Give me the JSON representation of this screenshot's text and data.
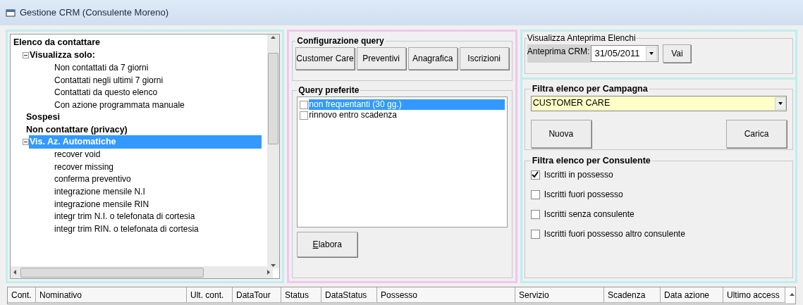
{
  "window": {
    "title": "Gestione CRM (Consulente Moreno)"
  },
  "tree": {
    "label": "Elenco da contattare",
    "selected": false,
    "children": [
      {
        "label": "Visualizza solo:",
        "selected": false,
        "expanded": true,
        "children": [
          {
            "label": "Non contattati da 7 giorni",
            "selected": false
          },
          {
            "label": "Contattati negli ultimi 7 giorni",
            "selected": false
          },
          {
            "label": "Contattati da questo elenco",
            "selected": false
          },
          {
            "label": "Con azione programmata manuale",
            "selected": false
          }
        ]
      },
      {
        "label": "Sospesi",
        "selected": false
      },
      {
        "label": "Non contattare (privacy)",
        "selected": false
      },
      {
        "label": "Vis. Az. Automatiche",
        "selected": true,
        "expanded": true,
        "children": [
          {
            "label": "recover void",
            "selected": false
          },
          {
            "label": "recover missing",
            "selected": false
          },
          {
            "label": "conferma preventivo",
            "selected": false
          },
          {
            "label": "integrazione mensile N.I",
            "selected": false
          },
          {
            "label": "integrazione mensile RIN",
            "selected": false
          },
          {
            "label": "integr trim N.I. o telefonata di cortesia",
            "selected": false
          },
          {
            "label": "integr trim RIN. o telefonata di cortesia",
            "selected": false
          }
        ]
      }
    ]
  },
  "query_config": {
    "title": "Configurazione query",
    "buttons": [
      "Customer Care",
      "Preventivi",
      "Anagrafica",
      "Iscrizioni"
    ]
  },
  "favorite_queries": {
    "title": "Query preferite",
    "items": [
      {
        "label": "non frequentanti (30 gg.)",
        "checked": false,
        "selected": true
      },
      {
        "label": "rinnovo entro scadenza",
        "checked": false,
        "selected": false
      }
    ],
    "button": "Elabora"
  },
  "preview": {
    "title": "Visualizza Anteprima Elenchi",
    "label": "Anteprima CRM:",
    "date": "31/05/2011",
    "button": "Vai"
  },
  "campaign_filter": {
    "title": "Filtra elenco per Campagna",
    "value": "CUSTOMER CARE",
    "buttons": [
      "Nuova",
      "Carica"
    ]
  },
  "consultant_filter": {
    "title": "Filtra elenco per Consulente",
    "options": [
      {
        "label": "Iscritti in possesso",
        "checked": true
      },
      {
        "label": "Iscritti fuori possesso",
        "checked": false
      },
      {
        "label": "Iscritti senza consulente",
        "checked": false
      },
      {
        "label": "Iscritti fuori possesso altro consulente",
        "checked": false
      }
    ]
  },
  "table": {
    "columns": [
      "Cont.",
      "Nominativo",
      "Ult. cont.",
      "DataTour",
      "Status",
      "DataStatus",
      "Possesso",
      "Servizio",
      "Scadenza",
      "Data azione",
      "Ultimo access"
    ]
  }
}
